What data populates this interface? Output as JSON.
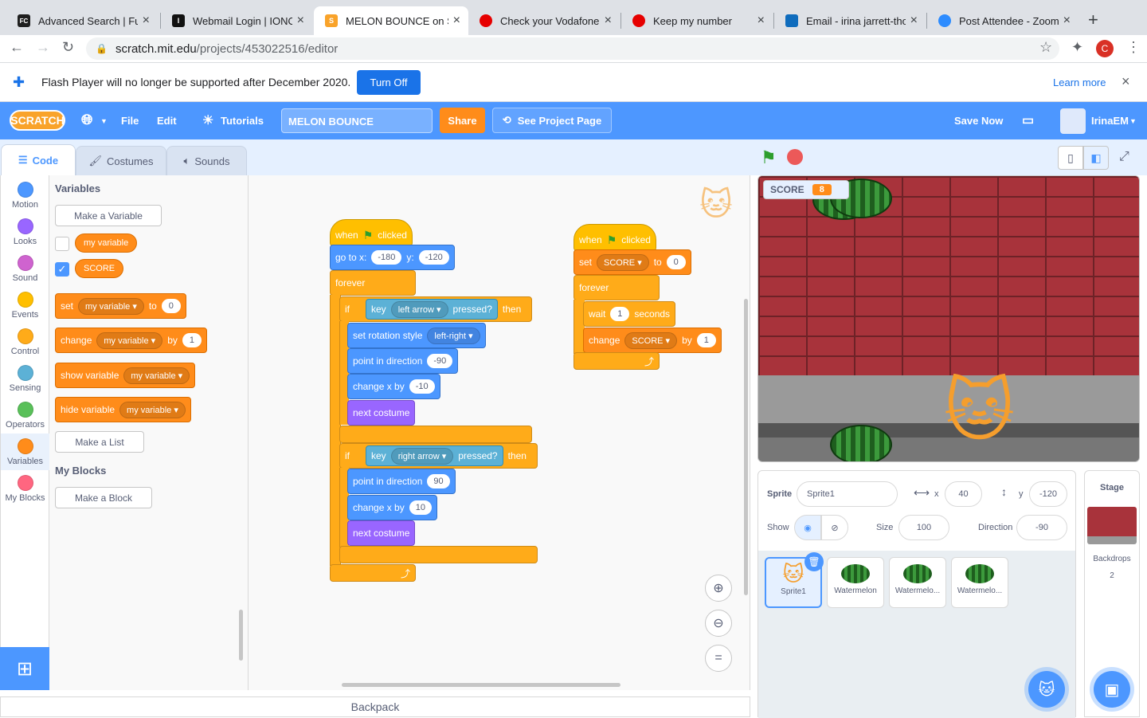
{
  "browser": {
    "tabs": [
      {
        "title": "Advanced Search | Fur",
        "favicon": "FC",
        "color": "#1f1f1f"
      },
      {
        "title": "Webmail Login | IONOS",
        "favicon": "I",
        "color": "#111111"
      },
      {
        "title": "MELON BOUNCE on Sc",
        "favicon": "S",
        "color": "#f9a32a"
      },
      {
        "title": "Check your Vodafone",
        "favicon": "O",
        "color": "#e60000"
      },
      {
        "title": "Keep my number",
        "favicon": "O",
        "color": "#e60000"
      },
      {
        "title": "Email - irina jarrett-tho",
        "favicon": "O",
        "color": "#0f6cbd"
      },
      {
        "title": "Post Attendee - Zoom",
        "favicon": "Z",
        "color": "#2d8cff"
      }
    ],
    "url_host": "scratch.mit.edu",
    "url_path": "/projects/453022516/editor",
    "profile_initial": "C"
  },
  "flash": {
    "message": "Flash Player will no longer be supported after December 2020.",
    "turn_off": "Turn Off",
    "learn_more": "Learn more"
  },
  "menubar": {
    "logo": "SCRATCH",
    "file": "File",
    "edit": "Edit",
    "tutorials": "Tutorials",
    "project_title": "MELON BOUNCE",
    "share": "Share",
    "see_project": "See Project Page",
    "save_now": "Save Now",
    "username": "IrinaEM"
  },
  "editor_tabs": {
    "code": "Code",
    "costumes": "Costumes",
    "sounds": "Sounds"
  },
  "categories": [
    {
      "label": "Motion",
      "color": "#4c97ff"
    },
    {
      "label": "Looks",
      "color": "#9966ff"
    },
    {
      "label": "Sound",
      "color": "#cf63cf"
    },
    {
      "label": "Events",
      "color": "#ffbf00"
    },
    {
      "label": "Control",
      "color": "#ffab19"
    },
    {
      "label": "Sensing",
      "color": "#5cb1d6"
    },
    {
      "label": "Operators",
      "color": "#59c059"
    },
    {
      "label": "Variables",
      "color": "#ff8c1a"
    },
    {
      "label": "My Blocks",
      "color": "#ff6680"
    }
  ],
  "palette": {
    "heading": "Variables",
    "make_variable": "Make a Variable",
    "var1": "my variable",
    "var2": "SCORE",
    "set_block": {
      "verb": "set",
      "var": "my variable",
      "to": "to",
      "value": "0"
    },
    "change_block": {
      "verb": "change",
      "var": "my variable",
      "by": "by",
      "value": "1"
    },
    "show_block": {
      "verb": "show variable",
      "var": "my variable"
    },
    "hide_block": {
      "verb": "hide variable",
      "var": "my variable"
    },
    "make_list": "Make a List",
    "myblocks_heading": "My Blocks",
    "make_block": "Make a Block"
  },
  "script1": {
    "when": "when",
    "clicked": "clicked",
    "goto": "go to x:",
    "x": "-180",
    "y_label": "y:",
    "y": "-120",
    "forever": "forever",
    "if": "if",
    "key": "key",
    "left_key": "left arrow",
    "pressed": "pressed?",
    "then": "then",
    "rot_style": "set rotation style",
    "rot_value": "left-right",
    "point": "point in direction",
    "dir_left": "-90",
    "change_x": "change x by",
    "dx_left": "-10",
    "next_costume": "next costume",
    "right_key": "right arrow",
    "dir_right": "90",
    "dx_right": "10"
  },
  "script2": {
    "when": "when",
    "clicked": "clicked",
    "set": "set",
    "var": "SCORE",
    "to": "to",
    "value": "0",
    "forever": "forever",
    "wait": "wait",
    "wait_value": "1",
    "seconds": "seconds",
    "change": "change",
    "by": "by",
    "change_value": "1"
  },
  "backpack": "Backpack",
  "stage": {
    "score_label": "SCORE",
    "score_value": "8"
  },
  "sprite_info": {
    "sprite_label": "Sprite",
    "sprite_name": "Sprite1",
    "x_label": "x",
    "x": "40",
    "y_label": "y",
    "y": "-120",
    "show_label": "Show",
    "size_label": "Size",
    "size": "100",
    "direction_label": "Direction",
    "direction": "-90",
    "sprites": [
      "Sprite1",
      "Watermelon",
      "Watermelo...",
      "Watermelo..."
    ]
  },
  "stage_panel": {
    "title": "Stage",
    "backdrops_label": "Backdrops",
    "backdrops_count": "2"
  }
}
